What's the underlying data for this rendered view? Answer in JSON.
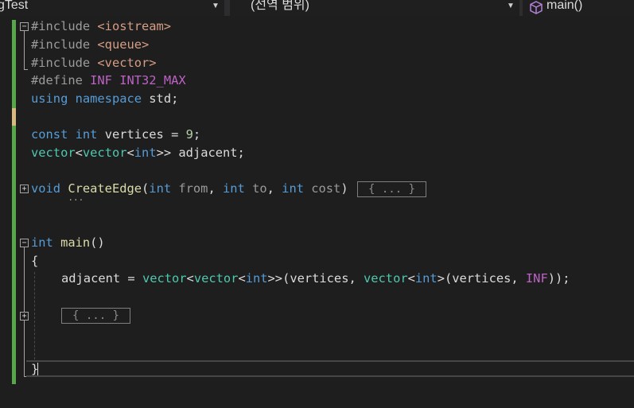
{
  "navbar": {
    "project": "gTest",
    "scope": "(선역 범위)",
    "member": "main()",
    "dropdown_arrow": "▼"
  },
  "editor": {
    "lines": {
      "l1": {
        "a": "#include ",
        "b": "<iostream>"
      },
      "l2": {
        "a": "#include ",
        "b": "<queue>"
      },
      "l3": {
        "a": "#include ",
        "b": "<vector>"
      },
      "l4": {
        "a": "#define ",
        "b": "INF ",
        "c": "INT32_MAX"
      },
      "l5": {
        "a": "using ",
        "b": "namespace ",
        "c": "std;"
      },
      "l7": {
        "a": "const ",
        "b": "int ",
        "c": "vertices = ",
        "d": "9",
        ";": ";"
      },
      "l8": {
        "a": "vector",
        "b": "<",
        "c": "vector",
        "d": "<",
        "e": "int",
        ">": ">> adjacent;"
      },
      "l10": {
        "a": "void ",
        "b": "CreateEdge",
        "c": "(",
        "d": "int ",
        "e": "from",
        ",1": ", ",
        "f": "int ",
        "g": "to",
        ",2": ", ",
        "h": "int ",
        "i": "cost",
        ")": ")"
      },
      "l13": {
        "a": "int ",
        "b": "main",
        "c": "()"
      },
      "l14": {
        "a": "{"
      },
      "l15": {
        "a": "adjacent = ",
        "b": "vector",
        "c": "<",
        "d": "vector",
        "e": "<",
        "f": "int",
        "g": ">>(vertices, ",
        "h": "vector",
        "i": "<",
        "j": "int",
        "k": ">(vertices, ",
        "l": "INF",
        "m": "));"
      },
      "l19": {
        "a": "}"
      }
    },
    "collapsed_1": "{ ... }",
    "collapsed_2": "{ ... }",
    "outline_minus": "−",
    "outline_plus": "+"
  }
}
